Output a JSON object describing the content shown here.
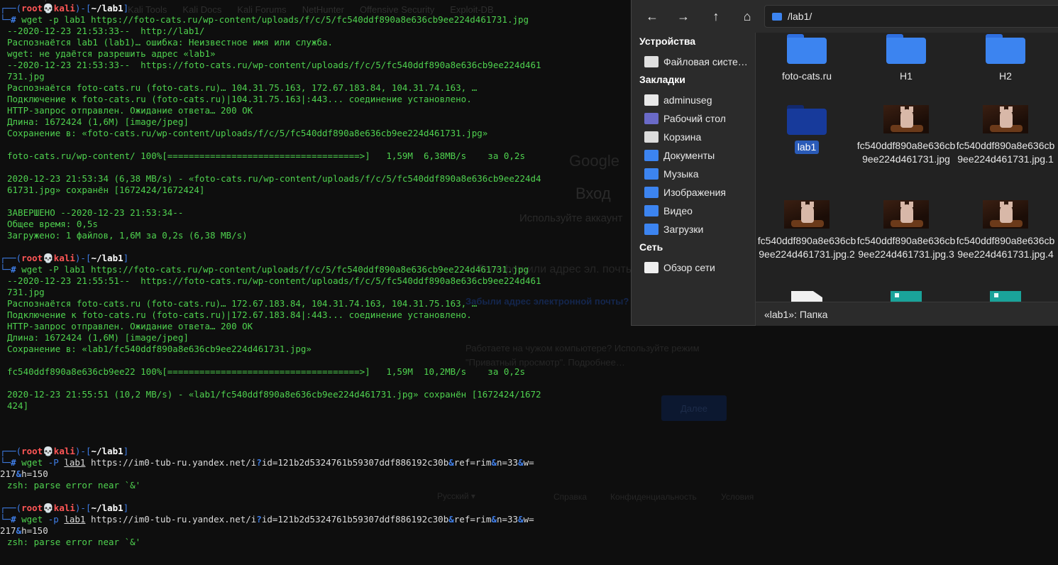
{
  "terminal": {
    "top_line": "  zsh: parse error near `&'",
    "blocks": [
      {
        "prompt": {
          "user": "root",
          "host": "kali",
          "dir": "~/lab1"
        },
        "command": "wget -p lab1 https://foto-cats.ru/wp-content/uploads/f/c/5/fc540ddf890a8e636cb9ee224d461731.jpg",
        "output": [
          "--2020-12-23 21:53:33--  http://lab1/",
          "Распознаётся lab1 (lab1)… ошибка: Неизвестное имя или служба.",
          "wget: не удаётся разрешить адрес «lab1»",
          "--2020-12-23 21:53:33--  https://foto-cats.ru/wp-content/uploads/f/c/5/fc540ddf890a8e636cb9ee224d461",
          "731.jpg",
          "Распознаётся foto-cats.ru (foto-cats.ru)… 104.31.75.163, 172.67.183.84, 104.31.74.163, …",
          "Подключение к foto-cats.ru (foto-cats.ru)|104.31.75.163|:443... соединение установлено.",
          "HTTP-запрос отправлен. Ожидание ответа… 200 OK",
          "Длина: 1672424 (1,6M) [image/jpeg]",
          "Сохранение в: «foto-cats.ru/wp-content/uploads/f/c/5/fc540ddf890a8e636cb9ee224d461731.jpg»",
          "",
          "foto-cats.ru/wp-content/ 100%[====================================>]   1,59M  6,38MB/s    за 0,2s",
          "",
          "2020-12-23 21:53:34 (6,38 MB/s) - «foto-cats.ru/wp-content/uploads/f/c/5/fc540ddf890a8e636cb9ee224d4",
          "61731.jpg» сохранён [1672424/1672424]",
          "",
          "ЗАВЕРШЕНО --2020-12-23 21:53:34--",
          "Общее время: 0,5s",
          "Загружено: 1 файлов, 1,6M за 0,2s (6,38 MB/s)"
        ]
      },
      {
        "prompt": {
          "user": "root",
          "host": "kali",
          "dir": "~/lab1"
        },
        "command": "wget -P lab1 https://foto-cats.ru/wp-content/uploads/f/c/5/fc540ddf890a8e636cb9ee224d461731.jpg",
        "output": [
          "--2020-12-23 21:55:51--  https://foto-cats.ru/wp-content/uploads/f/c/5/fc540ddf890a8e636cb9ee224d461",
          "731.jpg",
          "Распознаётся foto-cats.ru (foto-cats.ru)… 172.67.183.84, 104.31.74.163, 104.31.75.163, …",
          "Подключение к foto-cats.ru (foto-cats.ru)|172.67.183.84|:443... соединение установлено.",
          "HTTP-запрос отправлен. Ожидание ответа… 200 OK",
          "Длина: 1672424 (1,6M) [image/jpeg]",
          "Сохранение в: «lab1/fc540ddf890a8e636cb9ee224d461731.jpg»",
          "",
          "fc540ddf890a8e636cb9ee22 100%[====================================>]   1,59M  10,2MB/s    за 0,2s",
          "",
          "2020-12-23 21:55:51 (10,2 MB/s) - «lab1/fc540ddf890a8e636cb9ee224d461731.jpg» сохранён [1672424/1672",
          "424]"
        ]
      },
      {
        "prompt": {
          "user": "root",
          "host": "kali",
          "dir": "~/lab1"
        },
        "command_parts": [
          "wget",
          "-P",
          "lab1",
          "https://im0-tub-ru.yandex.net/i",
          "?",
          "id=121b2d5324761b59307ddf886192c30b",
          "&",
          "ref=rim",
          "&",
          "n=33",
          "&",
          "w="
        ],
        "command_cont": [
          "217",
          "&",
          "h=150"
        ],
        "output": [
          "zsh: parse error near `&'"
        ]
      },
      {
        "prompt": {
          "user": "root",
          "host": "kali",
          "dir": "~/lab1"
        },
        "command_parts": [
          "wget",
          "-p",
          "lab1",
          "https://im0-tub-ru.yandex.net/i",
          "?",
          "id=121b2d5324761b59307ddf886192c30b",
          "&",
          "ref=rim",
          "&",
          "n=33",
          "&",
          "w="
        ],
        "command_cont": [
          "217",
          "&",
          "h=150"
        ],
        "output": [
          "zsh: parse error near `&'"
        ]
      }
    ]
  },
  "file_manager": {
    "path": "/lab1/",
    "status": "«lab1»: Папка",
    "sidebar": {
      "devices_header": "Устройства",
      "devices": [
        {
          "label": "Файловая систе…",
          "icon": "drive-icon"
        }
      ],
      "bookmarks_header": "Закладки",
      "bookmarks": [
        {
          "label": "adminuseg",
          "icon": "home-folder-icon"
        },
        {
          "label": "Рабочий стол",
          "icon": "desktop-icon"
        },
        {
          "label": "Корзина",
          "icon": "trash-icon"
        },
        {
          "label": "Документы",
          "icon": "documents-icon"
        },
        {
          "label": "Музыка",
          "icon": "music-icon"
        },
        {
          "label": "Изображения",
          "icon": "pictures-icon"
        },
        {
          "label": "Видео",
          "icon": "video-icon"
        },
        {
          "label": "Загрузки",
          "icon": "downloads-icon"
        }
      ],
      "network_header": "Сеть",
      "network": [
        {
          "label": "Обзор сети",
          "icon": "network-icon"
        }
      ]
    },
    "items": [
      {
        "label": "foto-cats.ru",
        "type": "folder"
      },
      {
        "label": "H1",
        "type": "folder"
      },
      {
        "label": "H2",
        "type": "folder"
      },
      {
        "label": "lab1",
        "type": "folder",
        "selected": true
      },
      {
        "label": "fc540ddf890a8e636cb9ee224d461731.jpg",
        "type": "image"
      },
      {
        "label": "fc540ddf890a8e636cb9ee224d461731.jpg.1",
        "type": "image"
      },
      {
        "label": "fc540ddf890a8e636cb9ee224d461731.jpg.2",
        "type": "image"
      },
      {
        "label": "fc540ddf890a8e636cb9ee224d461731.jpg.3",
        "type": "image"
      },
      {
        "label": "fc540ddf890a8e636cb9ee224d461731.jpg.4",
        "type": "image"
      }
    ],
    "colors": {
      "folder": "#3c84f0",
      "selected": "#2a5bb8"
    }
  },
  "background_browser": {
    "bookmarks": [
      "Kali Tools",
      "Kali Docs",
      "Kali Forums",
      "NetHunter",
      "Offensive Security",
      "Exploit-DB"
    ],
    "brand": "Google",
    "heading": "Вход",
    "subheading": "Используйте аккаунт",
    "field_placeholder": "Телефон или адрес эл. почты",
    "forgot_email": "Забыли адрес электронной почты?",
    "guest_hint_1": "Работаете на чужом компьютере? Используйте режим",
    "guest_hint_2": "\"Приватный просмотр\".  Подробнее…",
    "next_button": "Далее",
    "footer_lang": "Русский ▾",
    "footer_links": [
      "Справка",
      "Конфиденциальность",
      "Условия"
    ]
  }
}
